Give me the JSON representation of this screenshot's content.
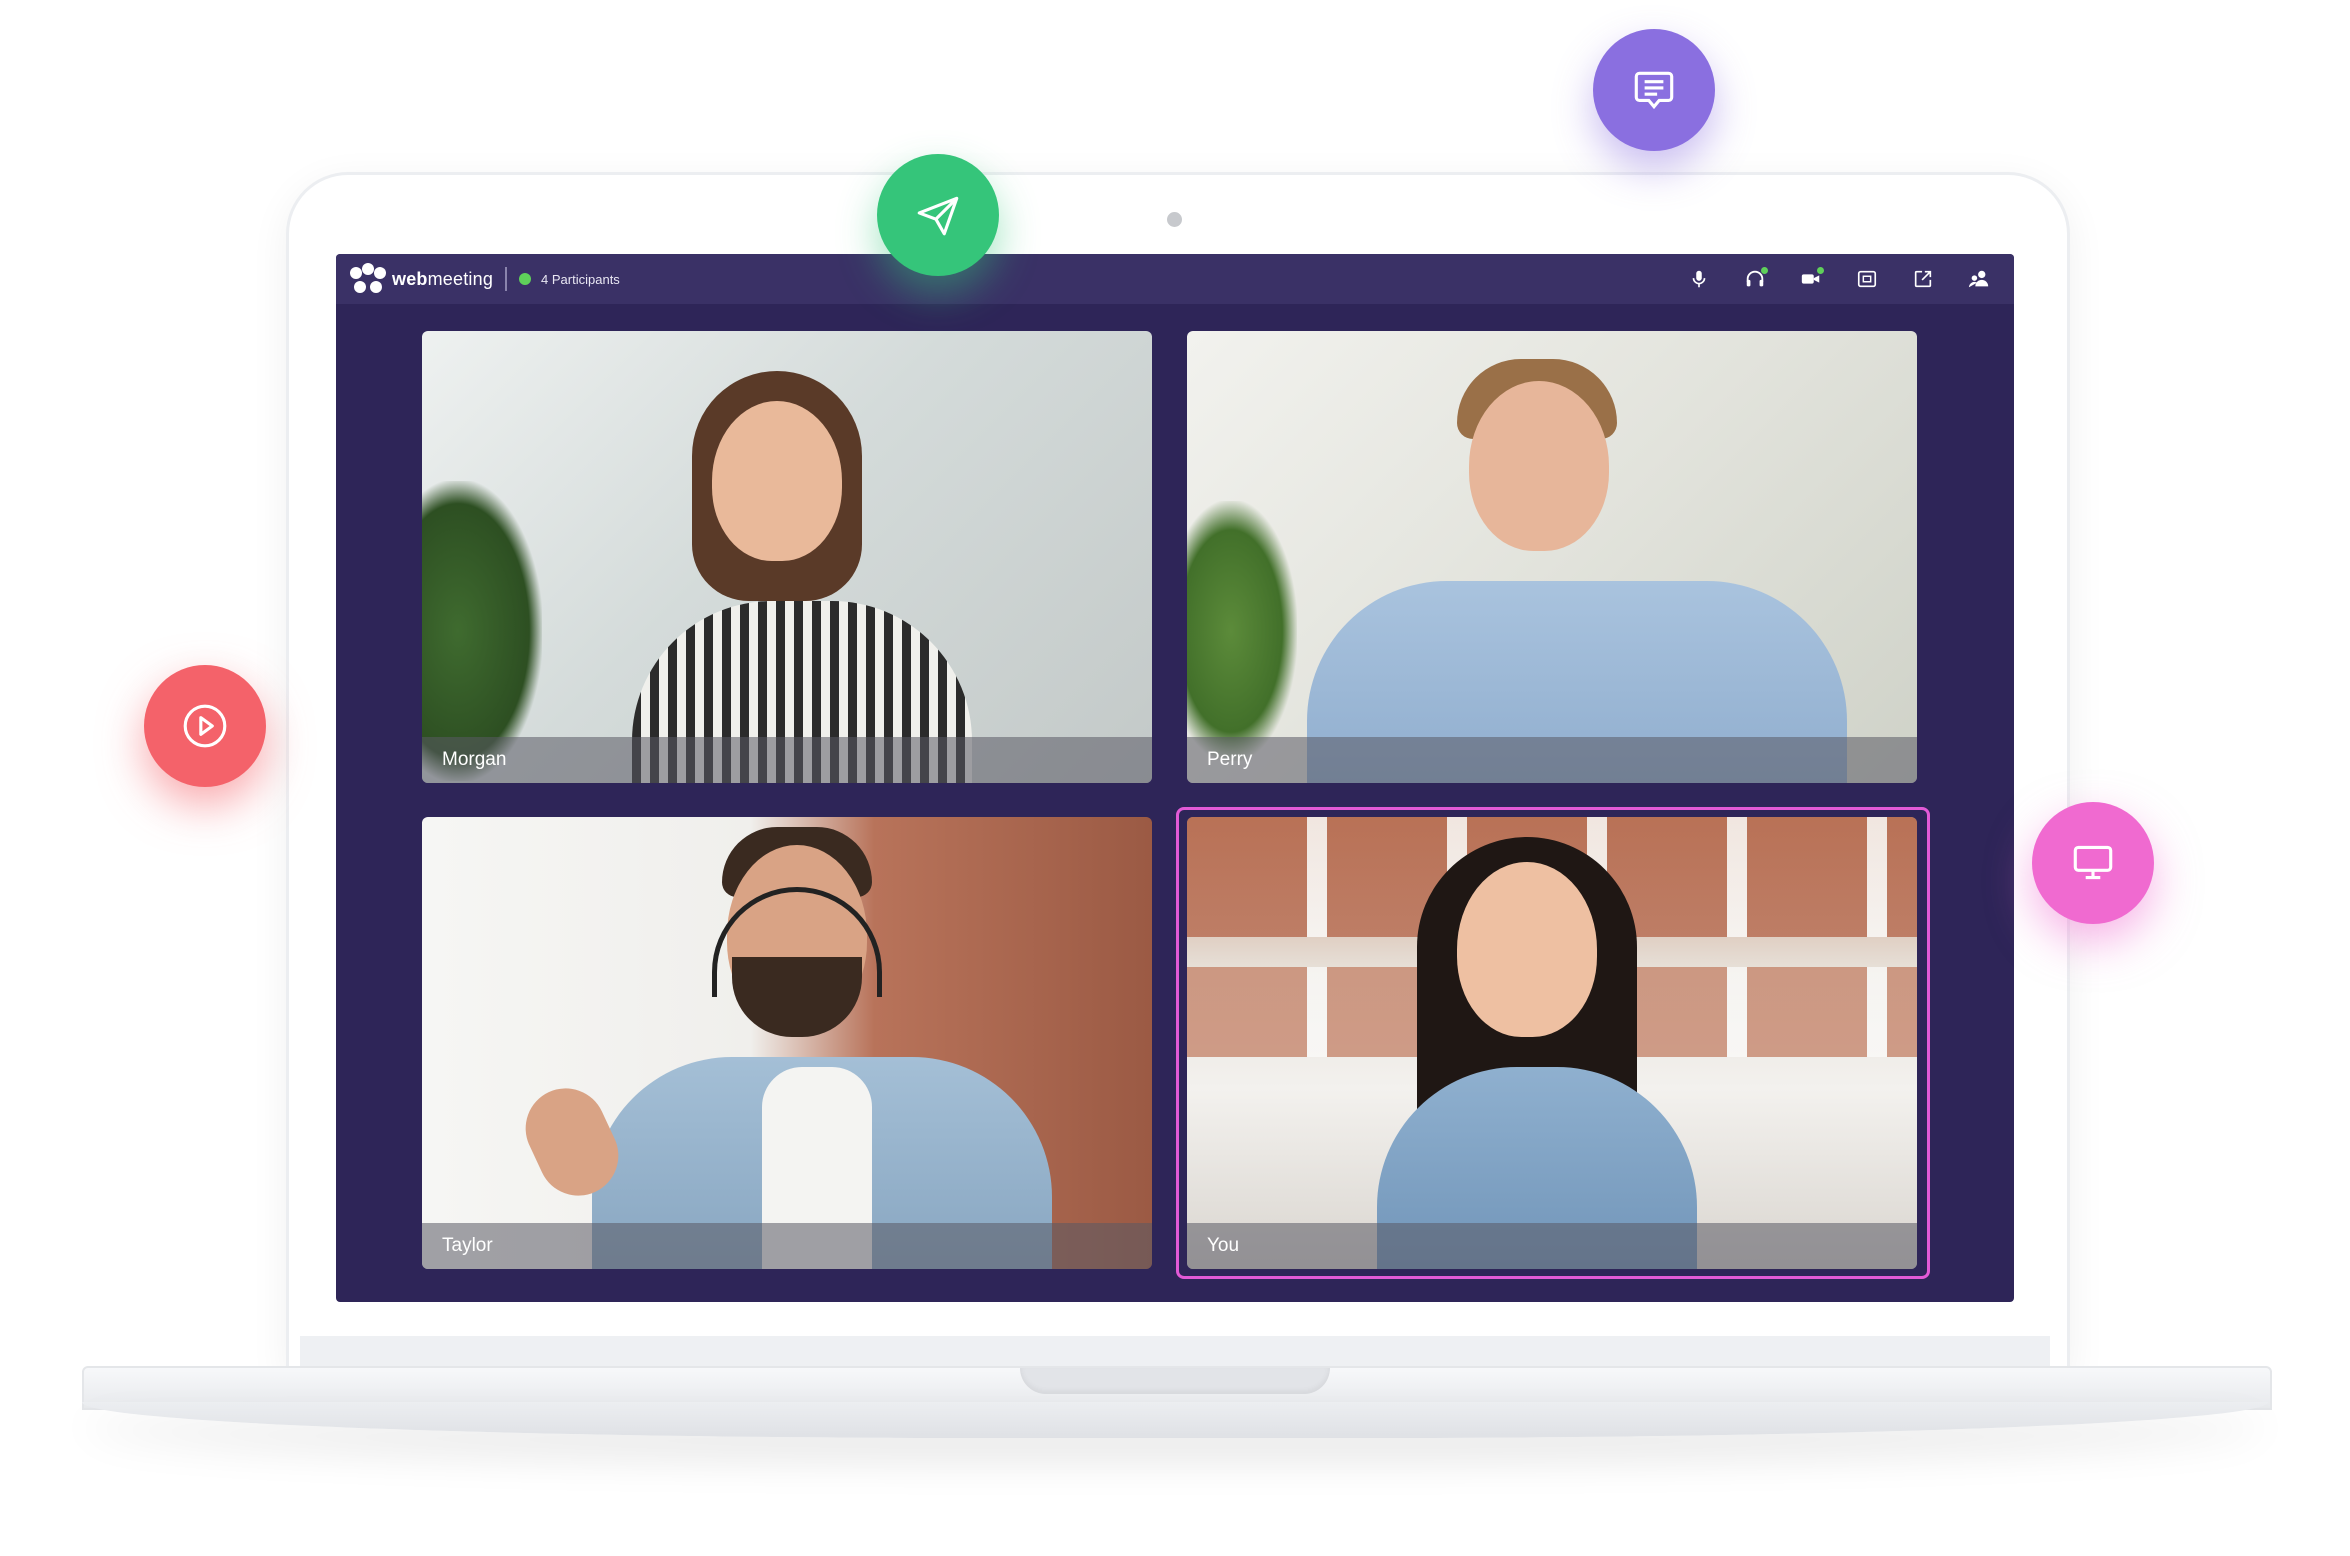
{
  "app": {
    "brand_bold": "web",
    "brand_rest": "meeting",
    "participants_label": "4 Participants"
  },
  "toolbar": {
    "icons": [
      "microphone-icon",
      "headset-icon",
      "camera-icon",
      "screen-share-icon",
      "popout-icon",
      "participants-icon"
    ]
  },
  "tiles": [
    {
      "name": "Morgan"
    },
    {
      "name": "Perry"
    },
    {
      "name": "Taylor"
    },
    {
      "name": "You",
      "active": true
    }
  ],
  "floating_actions": [
    "chat-icon",
    "send-icon",
    "play-icon",
    "monitor-icon"
  ],
  "colors": {
    "screen_bg": "#2e2558",
    "topbar_bg": "#3a3166",
    "status_green": "#5fd05a",
    "active_border": "#e25ad6",
    "chat_purple": "#8a6fe0",
    "send_green": "#35c57a",
    "play_red": "#f4626a",
    "screen_pink": "#f06ad0"
  }
}
